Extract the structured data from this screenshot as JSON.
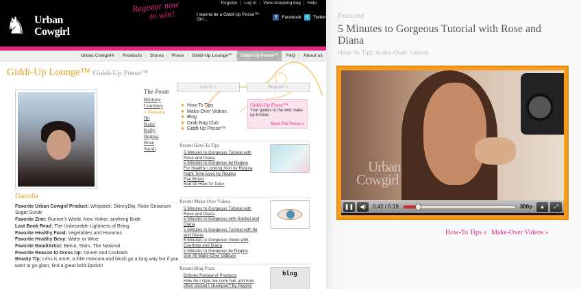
{
  "logo": {
    "line1": "Urban",
    "line2": "Cowgirl",
    "horse": "♞"
  },
  "promo": {
    "line1": "Register now",
    "line2": "to win!"
  },
  "top_links": [
    "Register",
    "Log In",
    "View shopping bag",
    "Help"
  ],
  "social": {
    "text": "I wanna be a Giddi-Up Posse™ Girl...",
    "facebook": "Facebook",
    "twitter": "Twitter"
  },
  "nav": [
    "Urban Cowgirl®",
    "Products",
    "Stores",
    "Press",
    "Giddi-Up Lounge™",
    "Giddi-Up Posse™",
    "FAQ",
    "About us"
  ],
  "lounge": {
    "title": "Giddi-Up Lounge™",
    "subtitle": "Giddi-Up Posse™"
  },
  "posse": {
    "heading": "The Posse",
    "members": [
      "Brittney",
      "Courtney",
      "» Daniella",
      "Ibi",
      "Katie",
      "Kelly",
      "Regina",
      "Rose",
      "Sarah"
    ]
  },
  "buttons": {
    "login": "Log-In »",
    "register": "Register »"
  },
  "menu": [
    "How-To Tips",
    "Make-Over Videos",
    "Blog",
    "Grab Bag Club",
    "Giddi-Up Posse™"
  ],
  "posse_box": {
    "title": "Giddi-Up Posse™",
    "desc": "Your guides to the wild make-up frontier.",
    "more": "Meet The Posse »"
  },
  "howto": {
    "heading": "Recent How-To Tips",
    "links": [
      "5 Minutes to Gorgeous Tutorial with Rose and Diana",
      "5 Minutes to Gorgeous by Regina",
      "For Healthy Looking Skin by Regina",
      "Night Time Eyes by Regina",
      "Eye Brows"
    ],
    "see_all": "See All How-To Tips»"
  },
  "makeover": {
    "heading": "Recent Make-Over Videos",
    "links": [
      "5 Minutes to Gorgeous Tutorial with Rose and Diana",
      "5 Minutes to Gorgeous with Rachel and Diana",
      "5 Minutes to Gorgeous Tutorial with Ibi and Diana",
      "5 Minutes to Gorgeous Video with Courtney and Diana",
      "5 Minutes to Gorgeous by Regina"
    ],
    "see_all": "See All Make-Over Videos»"
  },
  "blog": {
    "heading": "Recent Blog Posts",
    "links": [
      "Brittney Review of Products",
      "How do I style my curly hair and how often should I shampoo? by Regina"
    ],
    "thumb_label": "blog"
  },
  "profile": {
    "name": "Daniella",
    "fields": [
      {
        "label": "Favorite Urban Cowgirl Product:",
        "value": "Whipstick: SkinnyDip, Rose Geranium Sugar Scrub"
      },
      {
        "label": "Favorite Zine:",
        "value": "Runner's World, New Yorker, anything Bride"
      },
      {
        "label": "Last Book Read:",
        "value": "The Unbearable Lightness of Being"
      },
      {
        "label": "Favorite Healthy Food:",
        "value": "Vegetables and Hummus"
      },
      {
        "label": "Favorite Healthy Bevy:",
        "value": "Water or Wine"
      },
      {
        "label": "Favorite Band/Artist:",
        "value": "Beirut, Stars, The National"
      },
      {
        "label": "Favorite Reason to Dress Up:",
        "value": "Dinner and Cocktails"
      },
      {
        "label": "Beauty Tip:",
        "value": "Less is more, a little mascara and blush go a long way but if you want to go glam, find a great bold lipstick!"
      }
    ]
  },
  "featured": {
    "label": "Featured",
    "title": "5 Minutes to Gorgeous Tutorial with Rose and Diana",
    "subtitle": "How-To Tips Make-Over Videos"
  },
  "player": {
    "time": "0:42 / 5:19",
    "quality": "360p",
    "progress": 0.132,
    "watermark1": "Urban",
    "watermark2": "Cowgirl",
    "icons": [
      "pause-icon",
      "volume-icon",
      "expand-icon",
      "fullscreen-icon"
    ]
  },
  "bottom_links": [
    "How-To Tips »",
    "Make-Over Videos »"
  ],
  "colors": {
    "pink": "#e0267e",
    "orange": "#f49d20",
    "gold": "#e5a21d"
  }
}
